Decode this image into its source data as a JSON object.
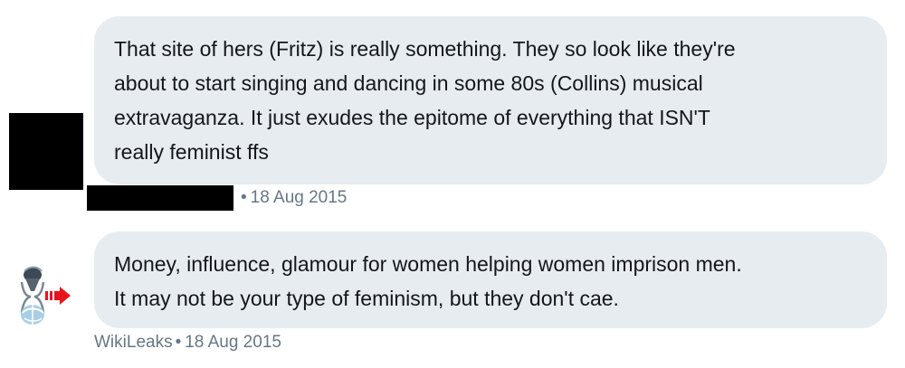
{
  "messages": [
    {
      "author": "",
      "text": "That site of hers (Fritz) is really something. They so look like they're\nabout to start singing and dancing in some 80s (Collins) musical\nextravaganza. It just exudes the epitome of everything that ISN'T\nreally feminist ffs",
      "separator": "•",
      "date": "18 Aug 2015",
      "avatar_icon": "redacted-avatar"
    },
    {
      "author": "WikiLeaks",
      "text": "Money, influence, glamour for women helping women imprison men.\nIt may not be your type of feminism, but they don't cae.",
      "separator": "•",
      "date": "18 Aug 2015",
      "avatar_icon": "wikileaks-hourglass-icon"
    }
  ],
  "colors": {
    "bubble_bg": "#e6ecf0",
    "text": "#14171a",
    "meta_text": "#657786",
    "redaction": "#000000",
    "arrow_red": "#e8141b"
  }
}
